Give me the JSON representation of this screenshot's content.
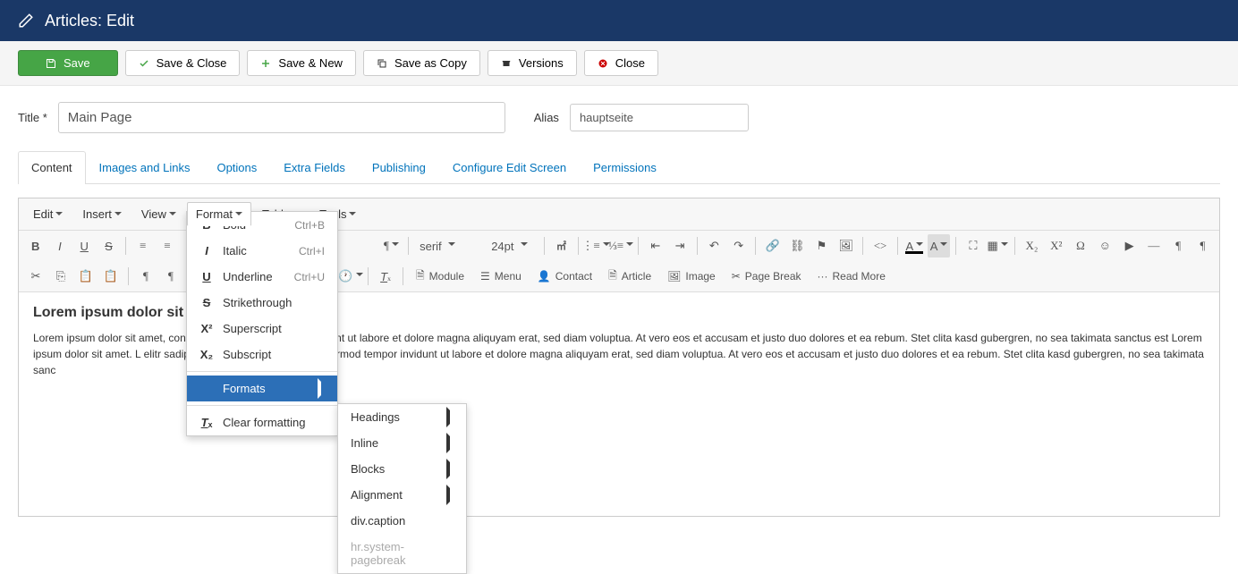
{
  "header": {
    "title": "Articles: Edit"
  },
  "toolbar": {
    "save": "Save",
    "save_close": "Save & Close",
    "save_new": "Save & New",
    "save_copy": "Save as Copy",
    "versions": "Versions",
    "close": "Close"
  },
  "form": {
    "title_label": "Title",
    "title_value": "Main Page",
    "alias_label": "Alias",
    "alias_value": "hauptseite"
  },
  "tabs": {
    "content": "Content",
    "images": "Images and Links",
    "options": "Options",
    "extra": "Extra Fields",
    "publishing": "Publishing",
    "configure": "Configure Edit Screen",
    "permissions": "Permissions"
  },
  "menubar": {
    "edit": "Edit",
    "insert": "Insert",
    "view": "View",
    "format": "Format",
    "table": "Table",
    "tools": "Tools"
  },
  "font": {
    "family": "serif",
    "size": "24pt"
  },
  "row2": {
    "module": "Module",
    "menu": "Menu",
    "contact": "Contact",
    "article": "Article",
    "image": "Image",
    "pagebreak": "Page Break",
    "readmore": "Read More"
  },
  "format_menu": {
    "bold": "Bold",
    "bold_sc": "Ctrl+B",
    "italic": "Italic",
    "italic_sc": "Ctrl+I",
    "underline": "Underline",
    "underline_sc": "Ctrl+U",
    "strike": "Strikethrough",
    "super": "Superscript",
    "sub": "Subscript",
    "formats": "Formats",
    "clear": "Clear formatting"
  },
  "formats_sub": {
    "headings": "Headings",
    "inline": "Inline",
    "blocks": "Blocks",
    "alignment": "Alignment",
    "divcaption": "div.caption",
    "hrpagebreak": "hr.system-pagebreak"
  },
  "content": {
    "heading": "Lorem ipsum dolor sit a",
    "body": "Lorem ipsum dolor sit amet, cons nonumy eirmod tempor invidunt ut labore et dolore magna aliquyam erat, sed diam voluptua. At vero eos et accusam et justo duo dolores et ea rebum. Stet clita kasd gubergren, no sea takimata sanctus est Lorem ipsum dolor sit amet. L elitr sadipscing elitr, sed diam nonumy eirmod tempor invidunt ut labore et dolore magna aliquyam erat, sed diam voluptua. At vero eos et accusam et justo duo dolores et ea rebum. Stet clita kasd gubergren, no sea takimata sanc"
  }
}
